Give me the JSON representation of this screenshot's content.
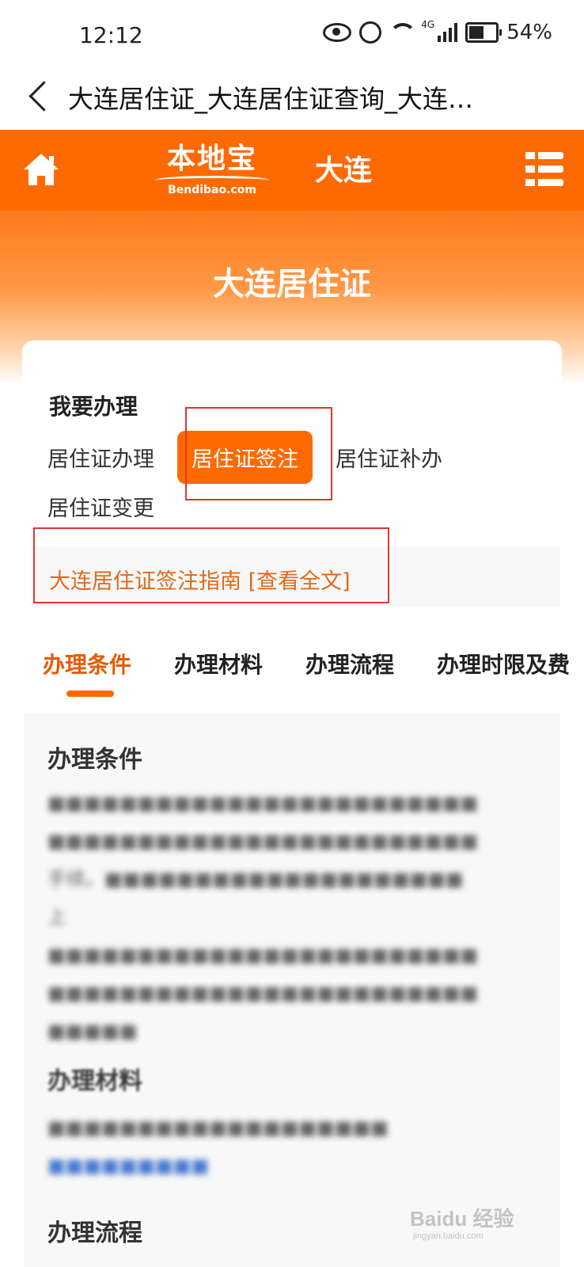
{
  "status_bar": {
    "time": "12:12",
    "network": "4G",
    "battery": "54%"
  },
  "title_bar": {
    "title": "大连居住证_大连居住证查询_大连…"
  },
  "header": {
    "logo_main": "本地宝",
    "logo_sub": "Bendibao.com",
    "city": "大连"
  },
  "banner": {
    "title": "大连居住证"
  },
  "card": {
    "section_title": "我要办理",
    "options": [
      "居住证办理",
      "居住证签注",
      "居住证补办",
      "居住证变更"
    ],
    "active_option": "居住证签注",
    "guide_link": "大连居住证签注指南 [查看全文]"
  },
  "tabs": [
    "办理条件",
    "办理材料",
    "办理流程",
    "办理时限及费"
  ],
  "active_tab": "办理条件",
  "content": {
    "sections": [
      {
        "title": "办理条件"
      },
      {
        "title": "办理材料"
      },
      {
        "title": "办理流程"
      }
    ],
    "blurred_fragments": [
      "手续。",
      "上"
    ]
  },
  "watermark": {
    "text": "Baidu 经验",
    "sub": "jingyan.baidu.com"
  },
  "colors": {
    "brand": "#ff6a00",
    "highlight_box": "#e0352b",
    "link": "#e06a1a"
  }
}
